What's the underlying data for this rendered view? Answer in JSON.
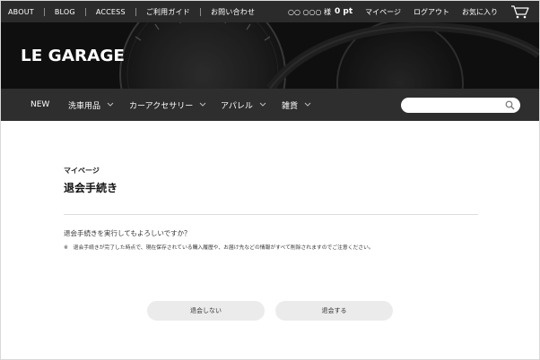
{
  "header": {
    "top_links": [
      "ABOUT",
      "BLOG",
      "ACCESS",
      "ご利用ガイド",
      "お問い合わせ"
    ],
    "user_name": "○○ ○○○ 様",
    "points": "0 pt",
    "right_links": [
      "マイページ",
      "ログアウト",
      "お気に入り"
    ],
    "logo_text": "LE GARAGE"
  },
  "nav": {
    "items": [
      {
        "label": "NEW"
      },
      {
        "label": "洗車用品"
      },
      {
        "label": "カーアクセサリー"
      },
      {
        "label": "アパレル"
      },
      {
        "label": "雑貨"
      }
    ],
    "search_placeholder": ""
  },
  "main": {
    "breadcrumb": "マイページ",
    "title": "退会手続き",
    "question": "退会手続きを実行してもよろしいですか？",
    "note": "※　退会手続きが完了した時点で、現在保存されている購入履歴や、お届け先などの情報がすべて削除されますのでご注意ください。",
    "cancel_label": "退会しない",
    "confirm_label": "退会する"
  },
  "colors": {
    "topbar": "#2b2b2b",
    "hero": "#151515",
    "navbar": "#2e2e2e",
    "button": "#ebebeb"
  }
}
